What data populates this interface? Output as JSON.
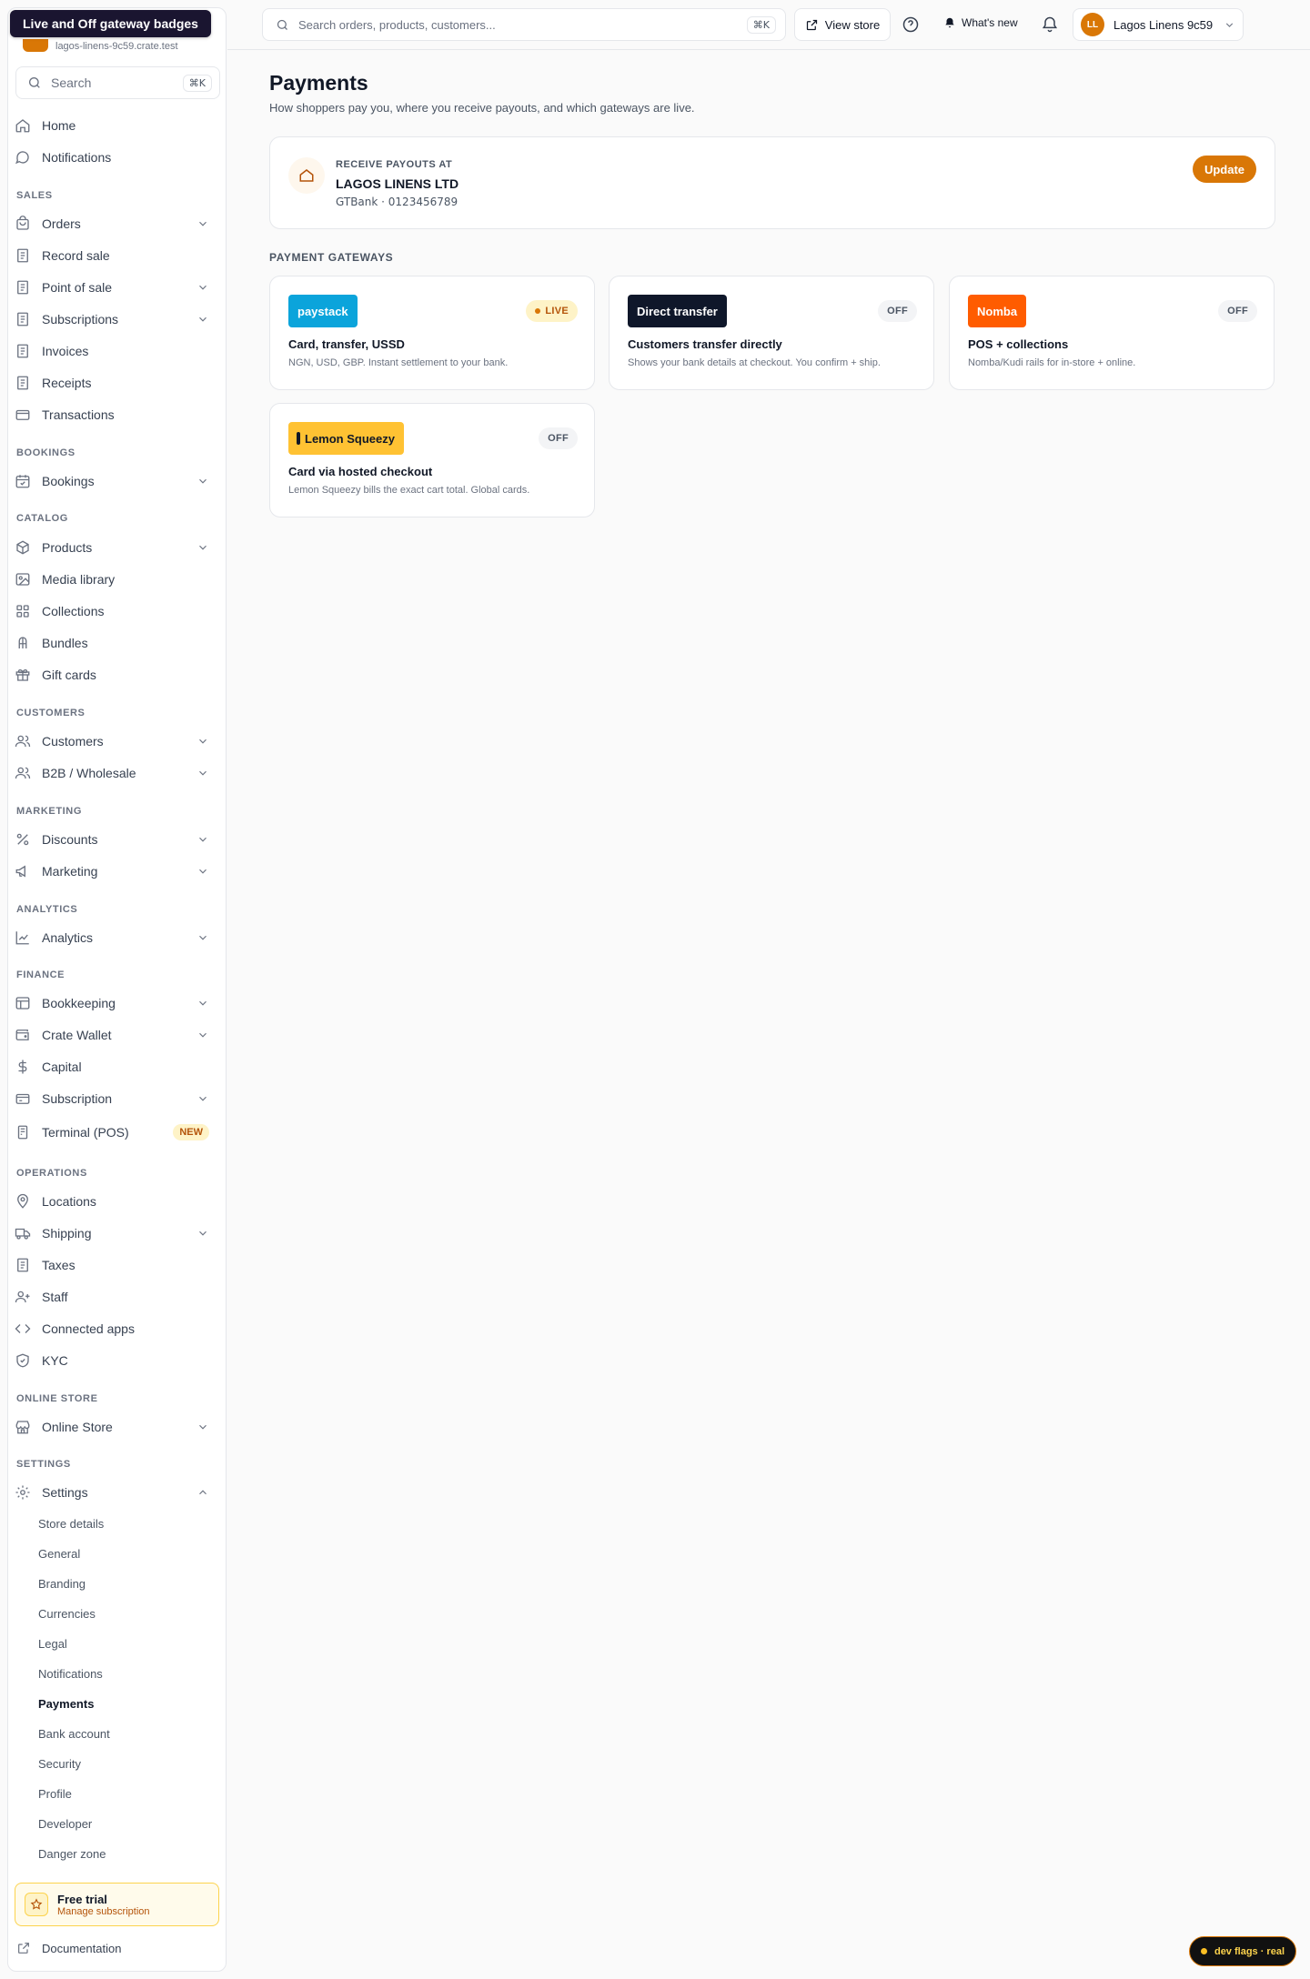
{
  "tooltip": "Live and Off gateway badges",
  "brand": {
    "subtitle": "lagos-linens-9c59.crate.test"
  },
  "sidebar": {
    "search_label": "Search",
    "search_kbd": "⌘K",
    "home": "Home",
    "notifications": "Notifications",
    "sections": {
      "sales": "SALES",
      "bookings": "BOOKINGS",
      "catalog": "CATALOG",
      "customers": "CUSTOMERS",
      "marketing": "MARKETING",
      "analytics": "ANALYTICS",
      "finance": "FINANCE",
      "operations": "OPERATIONS",
      "online_store": "ONLINE STORE",
      "settings": "SETTINGS"
    },
    "items": {
      "orders": "Orders",
      "record_sale": "Record sale",
      "point_of_sale": "Point of sale",
      "subscriptions": "Subscriptions",
      "invoices": "Invoices",
      "receipts": "Receipts",
      "transactions": "Transactions",
      "bookings": "Bookings",
      "products": "Products",
      "media_library": "Media library",
      "collections": "Collections",
      "bundles": "Bundles",
      "gift_cards": "Gift cards",
      "customers": "Customers",
      "b2b": "B2B / Wholesale",
      "discounts": "Discounts",
      "marketing": "Marketing",
      "analytics": "Analytics",
      "bookkeeping": "Bookkeeping",
      "crate_wallet": "Crate Wallet",
      "capital": "Capital",
      "subscription": "Subscription",
      "terminal": "Terminal (POS)",
      "terminal_badge": "NEW",
      "locations": "Locations",
      "shipping": "Shipping",
      "taxes": "Taxes",
      "staff": "Staff",
      "connected_apps": "Connected apps",
      "kyc": "KYC",
      "online_store": "Online Store",
      "settings": "Settings"
    },
    "settings_sub": [
      "Store details",
      "General",
      "Branding",
      "Currencies",
      "Legal",
      "Notifications",
      "Payments",
      "Bank account",
      "Security",
      "Profile",
      "Developer",
      "Danger zone"
    ],
    "settings_active": "Payments",
    "trial": {
      "title": "Free trial",
      "link": "Manage subscription"
    },
    "docs": "Documentation"
  },
  "topbar": {
    "search_placeholder": "Search orders, products, customers...",
    "search_kbd": "⌘K",
    "view_store": "View store",
    "whats_new": "What's new",
    "avatar_initials": "LL",
    "account_name": "Lagos Linens 9c59"
  },
  "page": {
    "title": "Payments",
    "subtitle": "How shoppers pay you, where you receive payouts, and which gateways are live."
  },
  "payout": {
    "label": "RECEIVE PAYOUTS AT",
    "account_name": "LAGOS LINENS LTD",
    "account_detail": "GTBank · 0123456789",
    "update_label": "Update"
  },
  "gateways": {
    "title": "PAYMENT GATEWAYS",
    "paystack": {
      "logo": "paystack",
      "status": "LIVE",
      "title": "Card, transfer, USSD",
      "desc": "NGN, USD, GBP. Instant settlement to your bank.",
      "color": "#0ba4db"
    },
    "direct": {
      "logo": "Direct transfer",
      "status": "OFF",
      "title": "Customers transfer directly",
      "desc": "Shows your bank details at checkout. You confirm + ship.",
      "color": "#0f172a"
    },
    "nomba": {
      "logo": "Nomba",
      "status": "OFF",
      "title": "POS + collections",
      "desc": "Nomba/Kudi rails for in-store + online.",
      "color": "#ff5c00"
    },
    "lemon": {
      "logo": "Lemon Squeezy",
      "status": "OFF",
      "title": "Card via hosted checkout",
      "desc": "Lemon Squeezy bills the exact cart total. Global cards.",
      "color": "#ffc233"
    }
  },
  "devflags": "dev flags · real",
  "colors": {
    "accent": "#d97706",
    "tooltip_bg": "#1a1530"
  }
}
